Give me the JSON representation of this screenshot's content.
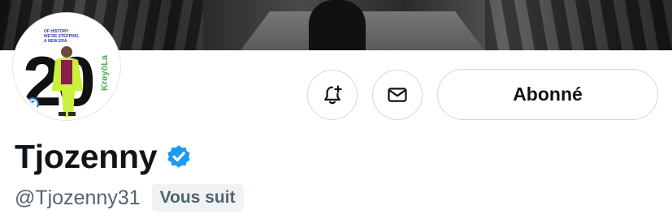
{
  "profile": {
    "display_name": "Tjozenny",
    "handle": "@Tjozenny31",
    "follows_you_badge": "Vous suit",
    "verified": true
  },
  "actions": {
    "follow_button_label": "Abonné",
    "notify_icon": "bell-plus-icon",
    "message_icon": "envelope-icon"
  },
  "avatar": {
    "logo_number": "20",
    "logo_brand": "KreyòLa",
    "logo_taglines": [
      "OF HISTORY",
      "WE'RE STEPPING",
      "A NEW ERA"
    ]
  },
  "colors": {
    "verified_blue": "#1d9bf0",
    "text_primary": "#0f1419",
    "text_secondary": "#536471",
    "border": "#cfd9de",
    "avatar_outfit": "#c8f03c",
    "avatar_brand_green": "#4caf50"
  }
}
